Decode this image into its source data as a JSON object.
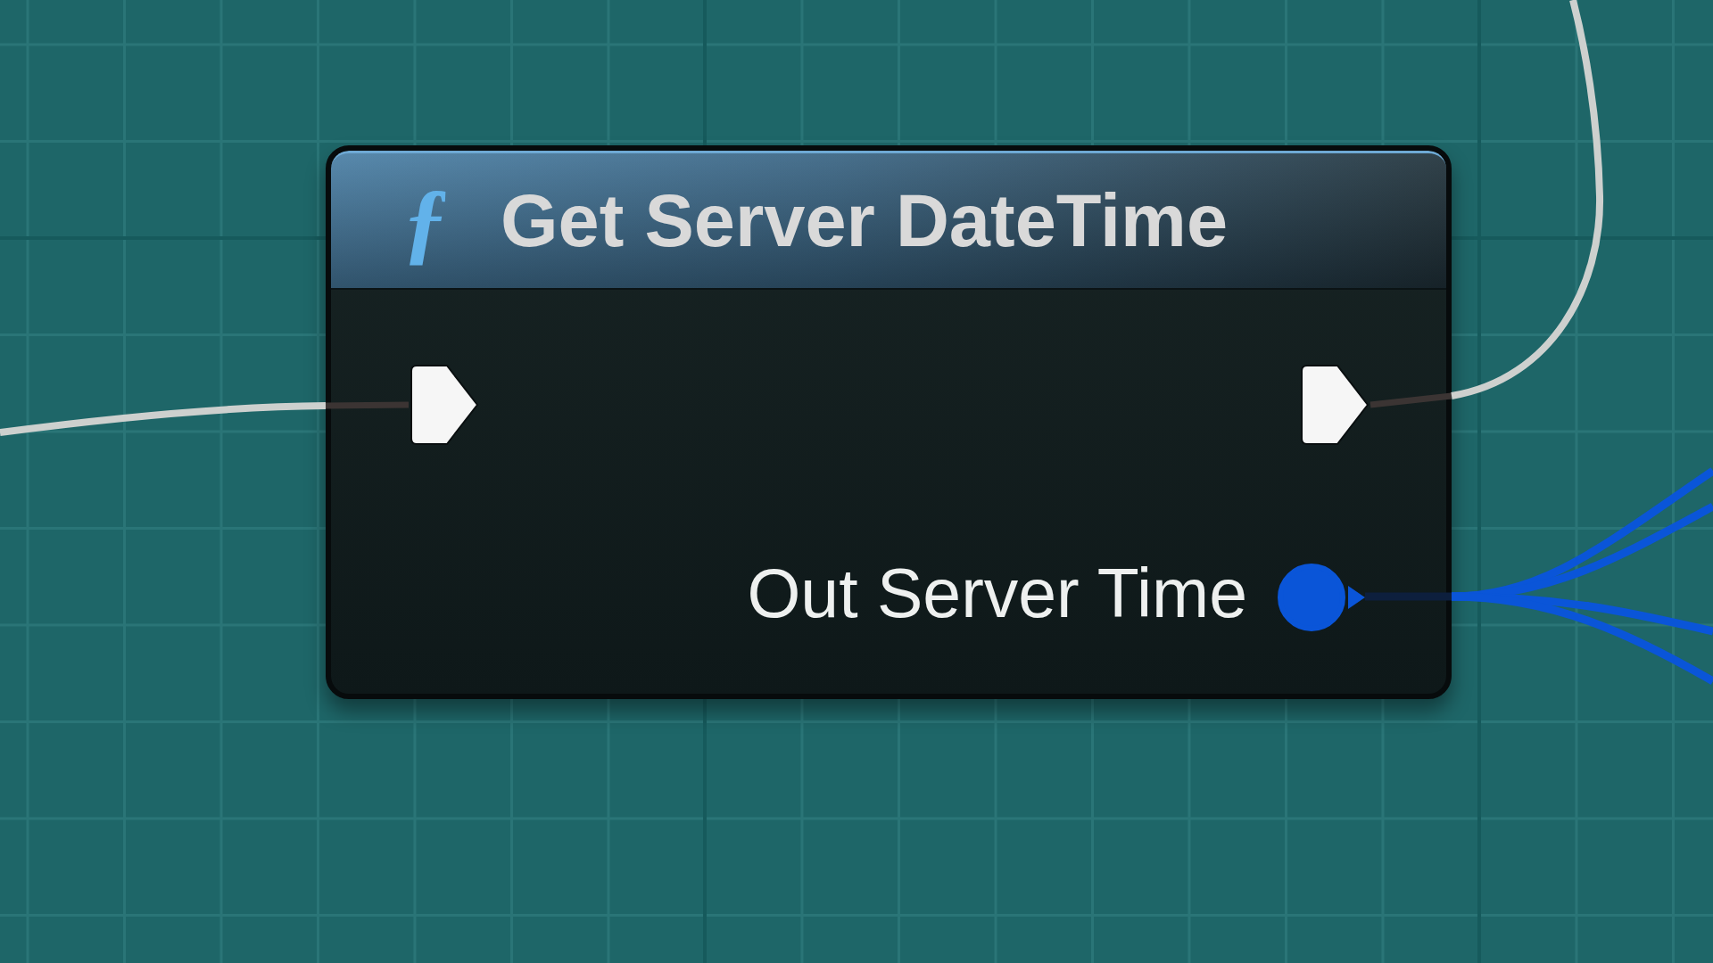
{
  "node": {
    "icon": "ƒ",
    "title": "Get Server DateTime",
    "inputs": [
      {
        "kind": "exec",
        "connected": true
      }
    ],
    "outputs": [
      {
        "kind": "exec",
        "connected": true
      },
      {
        "kind": "data",
        "label": "Out Server Time",
        "color": "#0a55d8",
        "connected": true
      }
    ]
  }
}
